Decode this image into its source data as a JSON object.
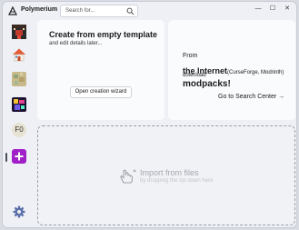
{
  "app": {
    "title": "Polymerium"
  },
  "search": {
    "placeholder": "Search for..."
  },
  "window_controls": {
    "minimize": "—",
    "maximize": "☐",
    "close": "✕"
  },
  "sidebar": {
    "items": [
      {
        "name": "instance-1",
        "kind": "pixel-avatar"
      },
      {
        "name": "instance-2",
        "kind": "house-icon"
      },
      {
        "name": "instance-3",
        "kind": "map-thumb"
      },
      {
        "name": "instance-4",
        "kind": "colorful-thumb"
      },
      {
        "name": "instance-5",
        "label": "F0"
      },
      {
        "name": "create-instance",
        "kind": "plus-icon",
        "selected": true
      }
    ]
  },
  "create_card": {
    "title": "Create from empty template",
    "subtitle": "and edit details later...",
    "button": "Open creation wizard"
  },
  "import_card": {
    "from": "From",
    "source_title": "the Internet",
    "source_detail": "(CurseForge, Modrinth)",
    "download": "download",
    "modpacks": "modpacks!",
    "link": "Go to Search Center"
  },
  "dropzone": {
    "title": "Import from files",
    "subtitle": "by dropping the zip down here"
  },
  "colors": {
    "accent": "#a020c8",
    "text": "#1a1a1a"
  }
}
